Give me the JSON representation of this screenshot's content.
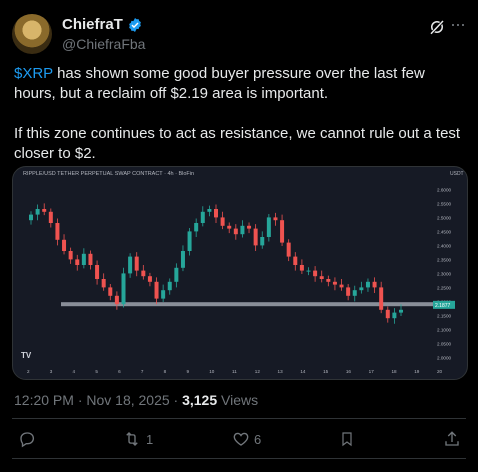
{
  "author": {
    "name": "ChiefraT",
    "handle": "@ChiefraFba"
  },
  "post": {
    "cashtag": "$XRP",
    "line1_rest": " has shown some good buyer pressure over the last few hours, but a reclaim off $2.19 area is important.",
    "para2": "If this zone continues to act as resistance, we cannot rule out a test closer to $2."
  },
  "chart": {
    "header": "RIPPLE/USD TETHER PERPETUAL SWAP CONTRACT · 4h · BloFin",
    "price_tag": "2.1877",
    "currency_tag": "USDT",
    "logo_text": "TV",
    "y_ticks": [
      "2.6000",
      "2.5500",
      "2.5000",
      "2.4500",
      "2.4000",
      "2.3500",
      "2.3000",
      "2.2500",
      "2.2000",
      "2.1500",
      "2.1000",
      "2.0500",
      "2.0000"
    ],
    "x_ticks": [
      "2",
      "3",
      "4",
      "5",
      "6",
      "7",
      "8",
      "9",
      "10",
      "11",
      "12",
      "13",
      "14",
      "15",
      "16",
      "17",
      "18",
      "19",
      "20"
    ],
    "colors": {
      "up": "#26a69a",
      "down": "#ef5350",
      "zone": "#9ea3ad",
      "bg": "#161a25"
    }
  },
  "chart_data": {
    "type": "candlestick",
    "title": "RIPPLE/USD TETHER PERPETUAL SWAP CONTRACT · 4h · BloFin",
    "ylim": [
      1.98,
      2.63
    ],
    "x": [
      "2",
      "3",
      "4",
      "5",
      "6",
      "7",
      "8",
      "9",
      "10",
      "11",
      "12",
      "13",
      "14",
      "15",
      "16",
      "17",
      "18",
      "19",
      "20"
    ],
    "closes_approx": [
      2.51,
      2.53,
      2.52,
      2.48,
      2.42,
      2.38,
      2.35,
      2.33,
      2.37,
      2.33,
      2.28,
      2.25,
      2.22,
      2.19,
      2.3,
      2.36,
      2.31,
      2.29,
      2.27,
      2.21,
      2.24,
      2.27,
      2.32,
      2.38,
      2.45,
      2.48,
      2.52,
      2.53,
      2.5,
      2.47,
      2.46,
      2.44,
      2.47,
      2.46,
      2.4,
      2.43,
      2.5,
      2.49,
      2.41,
      2.36,
      2.33,
      2.31,
      2.31,
      2.29,
      2.28,
      2.27,
      2.26,
      2.25,
      2.22,
      2.24,
      2.25,
      2.27,
      2.25,
      2.17,
      2.14,
      2.16,
      2.17
    ],
    "support_zone": 2.19,
    "last_price": 2.1877
  },
  "meta": {
    "time": "12:20 PM · Nov 18, 2025 · ",
    "views_count": "3,125",
    "views_label": " Views"
  },
  "actions": {
    "replies": "",
    "reposts": "1",
    "likes": "6"
  }
}
